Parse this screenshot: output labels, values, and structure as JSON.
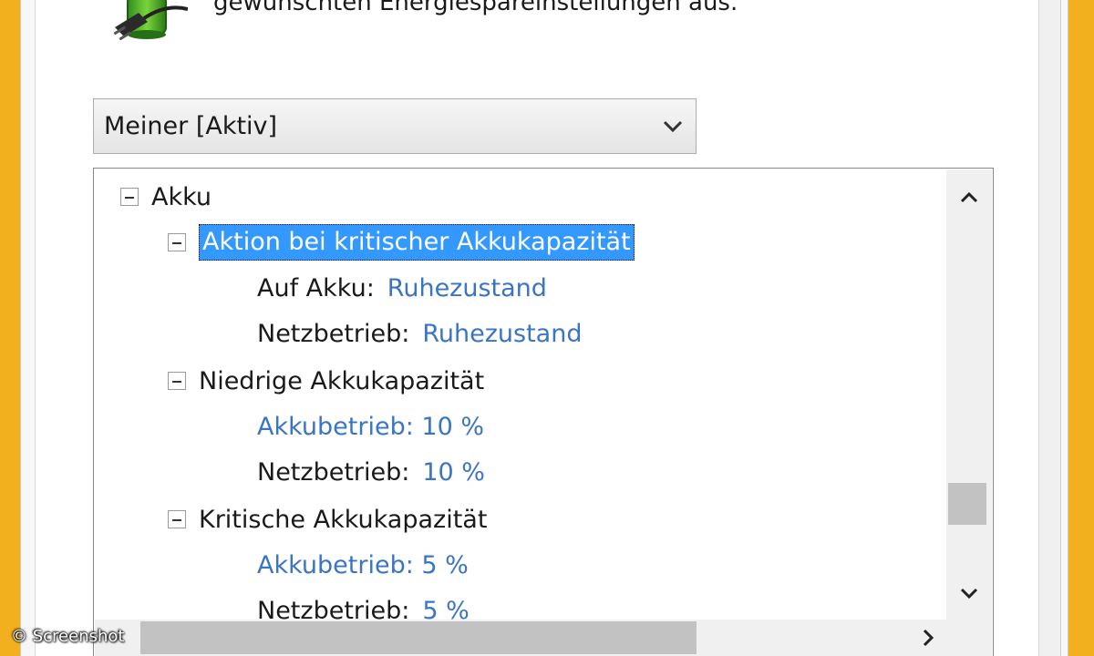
{
  "header": {
    "text": "gewünschten Energiespareinstellungen aus."
  },
  "plan_select": {
    "value": "Meiner [Aktiv]"
  },
  "tree": {
    "root_label": "Akku",
    "critical_action": {
      "label": "Aktion bei kritischer Akkukapazität",
      "on_battery_label": "Auf Akku:",
      "on_battery_value": "Ruhezustand",
      "plugged_in_label": "Netzbetrieb:",
      "plugged_in_value": "Ruhezustand"
    },
    "low_level": {
      "label": "Niedrige Akkukapazität",
      "on_battery": "Akkubetrieb: 10 %",
      "plugged_in_label": "Netzbetrieb:",
      "plugged_in_value": "10 %"
    },
    "critical_level": {
      "label": "Kritische Akkukapazität",
      "on_battery": "Akkubetrieb: 5 %",
      "plugged_in_label": "Netzbetrieb:",
      "plugged_in_value": "5 %"
    }
  },
  "watermark": "© Screenshot",
  "colors": {
    "frame": "#f2b01e",
    "selection": "#3399ff",
    "link": "#3a74c4"
  },
  "icons": [
    "power-plug-icon",
    "chevron-down-icon",
    "collapse-icon",
    "scroll-up-icon",
    "scroll-down-icon",
    "scroll-right-icon"
  ]
}
